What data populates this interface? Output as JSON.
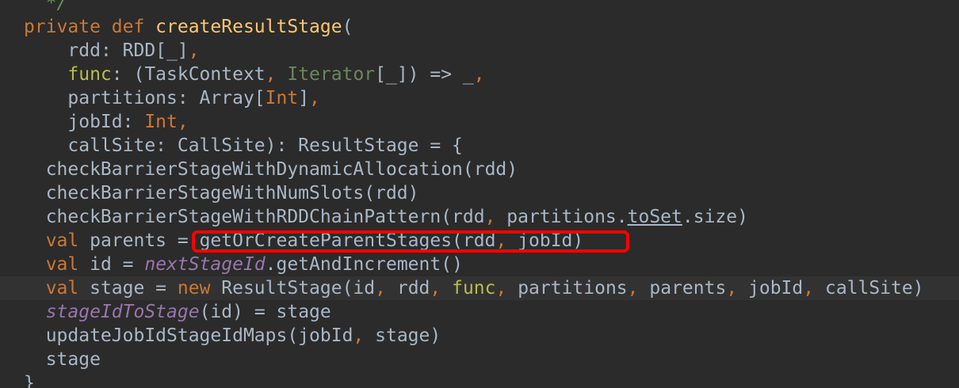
{
  "code_lines": [
    {
      "tokens": [
        {
          "t": "  */",
          "c": "cmt"
        }
      ]
    },
    {
      "tokens": [
        {
          "t": "private def ",
          "c": "kw"
        },
        {
          "t": "createResultStage",
          "c": "fn"
        },
        {
          "t": "(",
          "c": "plain"
        }
      ]
    },
    {
      "tokens": [
        {
          "t": "    rdd",
          "c": "plain"
        },
        {
          "t": ": RDD[_]",
          "c": "plain"
        },
        {
          "t": ",",
          "c": "kw"
        }
      ]
    },
    {
      "tokens": [
        {
          "t": "    ",
          "c": "plain"
        },
        {
          "t": "func",
          "c": "param"
        },
        {
          "t": ": (TaskContext",
          "c": "plain"
        },
        {
          "t": ", ",
          "c": "kw"
        },
        {
          "t": "Iterator",
          "c": "iter"
        },
        {
          "t": "[_]) => _",
          "c": "plain"
        },
        {
          "t": ",",
          "c": "kw"
        }
      ]
    },
    {
      "tokens": [
        {
          "t": "    partitions: Array[",
          "c": "plain"
        },
        {
          "t": "Int",
          "c": "kw"
        },
        {
          "t": "]",
          "c": "plain"
        },
        {
          "t": ",",
          "c": "kw"
        }
      ]
    },
    {
      "tokens": [
        {
          "t": "    jobId: ",
          "c": "plain"
        },
        {
          "t": "Int",
          "c": "kw"
        },
        {
          "t": ",",
          "c": "kw"
        }
      ]
    },
    {
      "tokens": [
        {
          "t": "    callSite: CallSite): ResultStage = {",
          "c": "plain"
        }
      ]
    },
    {
      "tokens": [
        {
          "t": "  checkBarrierStageWithDynamicAllocation(rdd)",
          "c": "plain"
        }
      ]
    },
    {
      "tokens": [
        {
          "t": "  checkBarrierStageWithNumSlots(rdd)",
          "c": "plain"
        }
      ]
    },
    {
      "tokens": [
        {
          "t": "  checkBarrierStageWithRDDChainPattern(rdd",
          "c": "plain"
        },
        {
          "t": ", ",
          "c": "kw"
        },
        {
          "t": "partitions.",
          "c": "plain"
        },
        {
          "t": "toSet",
          "c": "plain under"
        },
        {
          "t": ".size)",
          "c": "plain"
        }
      ]
    },
    {
      "tokens": [
        {
          "t": "  ",
          "c": "plain"
        },
        {
          "t": "val ",
          "c": "kw"
        },
        {
          "t": "parents = getOrCreateParentStages(rdd",
          "c": "plain"
        },
        {
          "t": ", ",
          "c": "kw"
        },
        {
          "t": "jobId)",
          "c": "plain"
        }
      ]
    },
    {
      "tokens": [
        {
          "t": "  ",
          "c": "plain"
        },
        {
          "t": "val ",
          "c": "kw"
        },
        {
          "t": "id = ",
          "c": "plain"
        },
        {
          "t": "nextStageId",
          "c": "field-italic"
        },
        {
          "t": ".getAndIncrement()",
          "c": "plain"
        }
      ]
    },
    {
      "tokens": [
        {
          "t": "  ",
          "c": "plain"
        },
        {
          "t": "val ",
          "c": "kw"
        },
        {
          "t": "stage = ",
          "c": "plain"
        },
        {
          "t": "new ",
          "c": "kw"
        },
        {
          "t": "ResultStage(id",
          "c": "plain"
        },
        {
          "t": ", ",
          "c": "kw"
        },
        {
          "t": "rdd",
          "c": "plain"
        },
        {
          "t": ", ",
          "c": "kw"
        },
        {
          "t": "func",
          "c": "param"
        },
        {
          "t": ", ",
          "c": "kw"
        },
        {
          "t": "partitions",
          "c": "plain"
        },
        {
          "t": ", ",
          "c": "kw"
        },
        {
          "t": "parents",
          "c": "plain"
        },
        {
          "t": ", ",
          "c": "kw"
        },
        {
          "t": "jobId",
          "c": "plain"
        },
        {
          "t": ", ",
          "c": "kw"
        },
        {
          "t": "callSite)",
          "c": "plain"
        }
      ],
      "current": true
    },
    {
      "tokens": [
        {
          "t": "  ",
          "c": "plain"
        },
        {
          "t": "stageIdToStage",
          "c": "field-italic"
        },
        {
          "t": "(id) = stage",
          "c": "plain"
        }
      ]
    },
    {
      "tokens": [
        {
          "t": "  updateJobIdStageIdMaps(jobId",
          "c": "plain"
        },
        {
          "t": ", ",
          "c": "kw"
        },
        {
          "t": "stage)",
          "c": "plain"
        }
      ]
    },
    {
      "tokens": [
        {
          "t": "  stage",
          "c": "plain"
        }
      ]
    },
    {
      "tokens": [
        {
          "t": "}",
          "c": "plain"
        }
      ]
    }
  ],
  "colors": {
    "background": "#2b2b2b",
    "keyword": "#cc7832",
    "function_name": "#ffc66d",
    "identifier": "#a9b7c6",
    "static_field": "#9876aa",
    "highlight_box": "#ff0000"
  }
}
